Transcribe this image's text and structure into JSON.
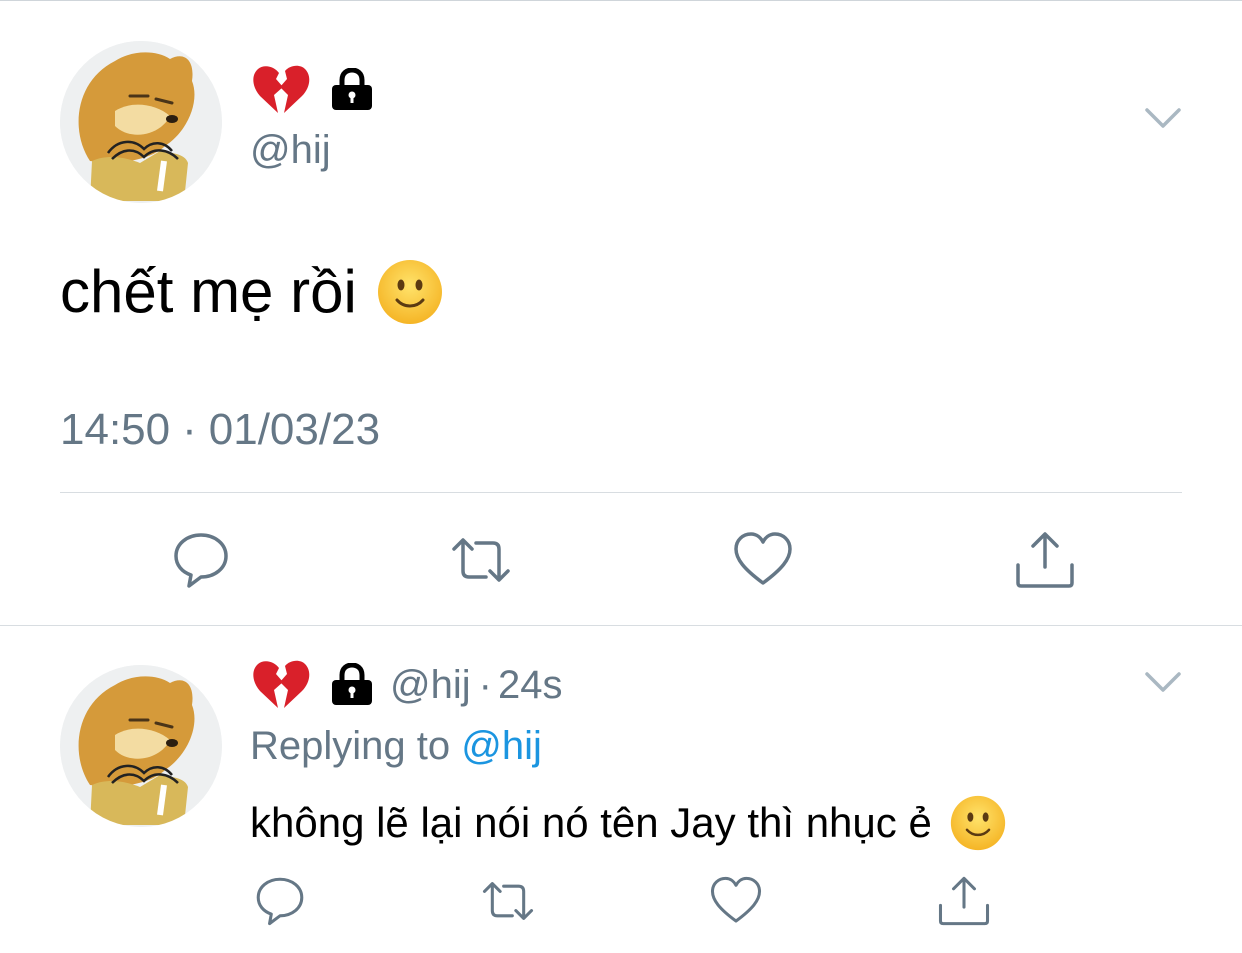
{
  "main_tweet": {
    "name_icons": [
      "broken-heart-icon",
      "lock-icon"
    ],
    "handle": "@hij",
    "text": "chết mẹ rồi",
    "text_emoji": "slightly-smiling-face-icon",
    "time": "14:50",
    "dot": "·",
    "date": "01/03/23",
    "actions": [
      "reply-icon",
      "retweet-icon",
      "like-icon",
      "share-icon"
    ]
  },
  "reply_tweet": {
    "name_icons": [
      "broken-heart-icon",
      "lock-icon"
    ],
    "handle": "@hij",
    "dot": "·",
    "age": "24s",
    "replying_prefix": "Replying to",
    "replying_handle": "@hij",
    "text": "không lẽ lại nói nó tên Jay thì nhục ẻ",
    "text_emoji": "slightly-smiling-face-icon",
    "actions": [
      "reply-icon",
      "retweet-icon",
      "like-icon",
      "share-icon"
    ]
  },
  "colors": {
    "secondary_text": "#657786",
    "mention": "#1b95e0",
    "icon": "#657786",
    "divider": "#d8dde1"
  }
}
